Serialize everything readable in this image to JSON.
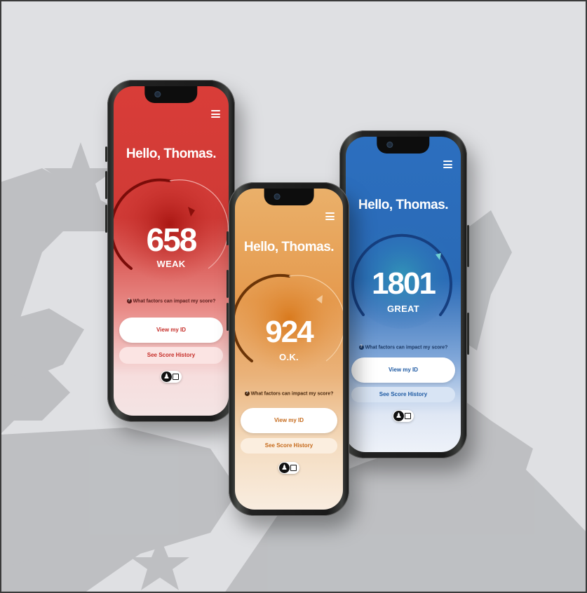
{
  "phones": [
    {
      "id": "red",
      "greeting": "Hello, Thomas.",
      "score": "658",
      "rating": "WEAK",
      "score_fraction": 0.45,
      "factors_text": "What factors can impact my score?",
      "primary_button": "View my ID",
      "secondary_button": "See Score History",
      "colors": {
        "top": "#d63b35",
        "bottom": "#f3dcdc",
        "accent": "#c62d28"
      }
    },
    {
      "id": "orange",
      "greeting": "Hello, Thomas.",
      "score": "924",
      "rating": "O.K.",
      "score_fraction": 0.6,
      "factors_text": "What factors can impact my score?",
      "primary_button": "View my ID",
      "secondary_button": "See Score History",
      "colors": {
        "top": "#e39a4d",
        "bottom": "#f7e9da",
        "accent": "#c66a1b"
      }
    },
    {
      "id": "blue",
      "greeting": "Hello, Thomas.",
      "score": "1801",
      "rating": "GREAT",
      "score_fraction": 0.92,
      "factors_text": "What factors can impact my score?",
      "primary_button": "View my ID",
      "secondary_button": "See Score History",
      "colors": {
        "top": "#2f73c0",
        "bottom": "#e2eaf6",
        "accent": "#1e5aa3"
      }
    }
  ],
  "icons": [
    "menu-icon",
    "question-icon",
    "person-icon",
    "chat-icon"
  ]
}
